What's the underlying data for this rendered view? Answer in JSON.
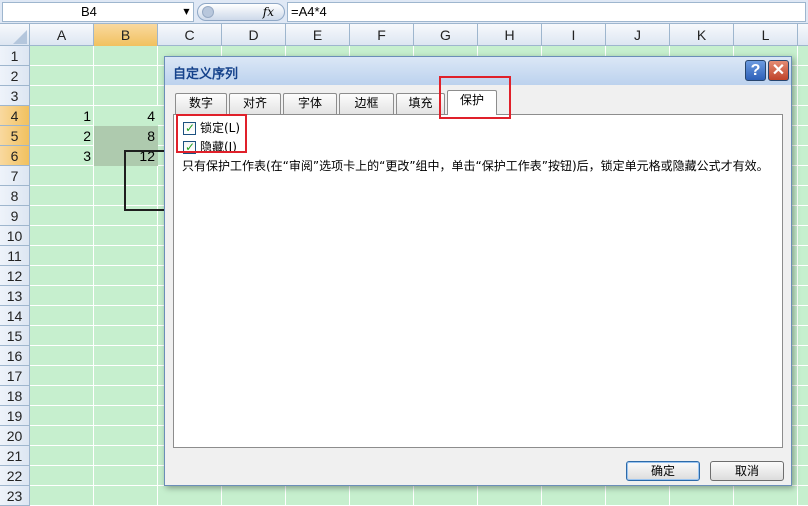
{
  "formula_bar": {
    "name_box": "B4",
    "fx_label": "fx",
    "formula": "=A4*4"
  },
  "columns": [
    "A",
    "B",
    "C",
    "D",
    "E",
    "F",
    "G",
    "H",
    "I",
    "J",
    "K",
    "L"
  ],
  "selected_column": "B",
  "rows": [
    "1",
    "2",
    "3",
    "4",
    "5",
    "6",
    "7",
    "8",
    "9",
    "10",
    "11",
    "12",
    "13",
    "14",
    "15",
    "16",
    "17",
    "18",
    "19",
    "20",
    "21",
    "22",
    "23"
  ],
  "selected_rows": [
    "4",
    "5",
    "6"
  ],
  "cells": [
    {
      "ref": "A4",
      "value": "1"
    },
    {
      "ref": "B4",
      "value": "4"
    },
    {
      "ref": "A5",
      "value": "2"
    },
    {
      "ref": "B5",
      "value": "8"
    },
    {
      "ref": "A6",
      "value": "3"
    },
    {
      "ref": "B6",
      "value": "12"
    }
  ],
  "dialog": {
    "title": "自定义序列",
    "help_label": "?",
    "close_label": "✕",
    "tabs": [
      {
        "label": "数字",
        "active": false
      },
      {
        "label": "对齐",
        "active": false
      },
      {
        "label": "字体",
        "active": false
      },
      {
        "label": "边框",
        "active": false
      },
      {
        "label": "填充",
        "active": false
      },
      {
        "label": "保护",
        "active": true
      }
    ],
    "checkboxes": [
      {
        "label": "锁定(L)",
        "checked": true
      },
      {
        "label": "隐藏(I)",
        "checked": true
      }
    ],
    "description": "只有保护工作表(在“审阅”选项卡上的“更改”组中，单击“保护工作表”按钮)后，锁定单元格或隐藏公式才有效。",
    "ok_label": "确定",
    "cancel_label": "取消"
  },
  "colors": {
    "sheet_background": "#c6efce",
    "header_selected": "#f1c15f",
    "highlight": "#e0202a",
    "dialog_title": "#15428b"
  }
}
